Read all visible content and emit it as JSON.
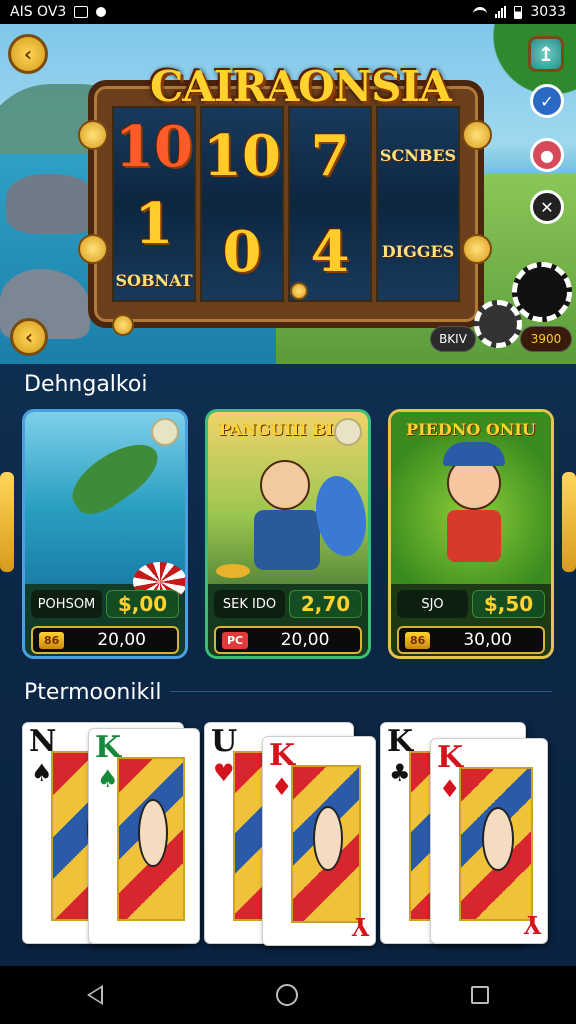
{
  "status_bar": {
    "carrier": "AIS OV3",
    "time": "3033"
  },
  "hero": {
    "title": "CAIRAONSIA",
    "reels": [
      {
        "top": "10",
        "bottom": "1",
        "bottom_label": "SOBNAT"
      },
      {
        "top": "10",
        "bottom": "0"
      },
      {
        "top": "7",
        "bottom": "4"
      },
      {
        "top_label": "SCNBES",
        "bottom_label": "DIGGES"
      }
    ],
    "balance_label": "BKIV",
    "balance_value": "3900"
  },
  "section1": {
    "title": "Dehngalkoi"
  },
  "games": [
    {
      "caption": "",
      "label": "POHSOM",
      "value": "$,00",
      "badge": "86",
      "amount": "20,00"
    },
    {
      "caption": "PANGUIII BIAS",
      "label": "SEK IDO",
      "value": "2,70",
      "badge": "PC",
      "amount": "20,00"
    },
    {
      "caption": "PIEDNO ONIU",
      "label": "SJO",
      "value": "$,50",
      "badge": "86",
      "amount": "30,00"
    }
  ],
  "section2": {
    "title": "Ptermoonikil"
  },
  "cards": [
    {
      "rank": "N",
      "suit": "♠",
      "color": "black"
    },
    {
      "rank": "K",
      "suit": "♠",
      "color": "green"
    },
    {
      "rank": "U",
      "suit": "♥",
      "color": "black"
    },
    {
      "rank": "K",
      "suit": "♦",
      "color": "red"
    },
    {
      "rank": "K",
      "suit": "♣",
      "color": "black"
    },
    {
      "rank": "K",
      "suit": "♦",
      "color": "red"
    }
  ],
  "card_back_ranks": [
    "Y",
    "Y"
  ],
  "icons": {
    "back": "chevron-left-icon",
    "settings": "badge-icon"
  }
}
